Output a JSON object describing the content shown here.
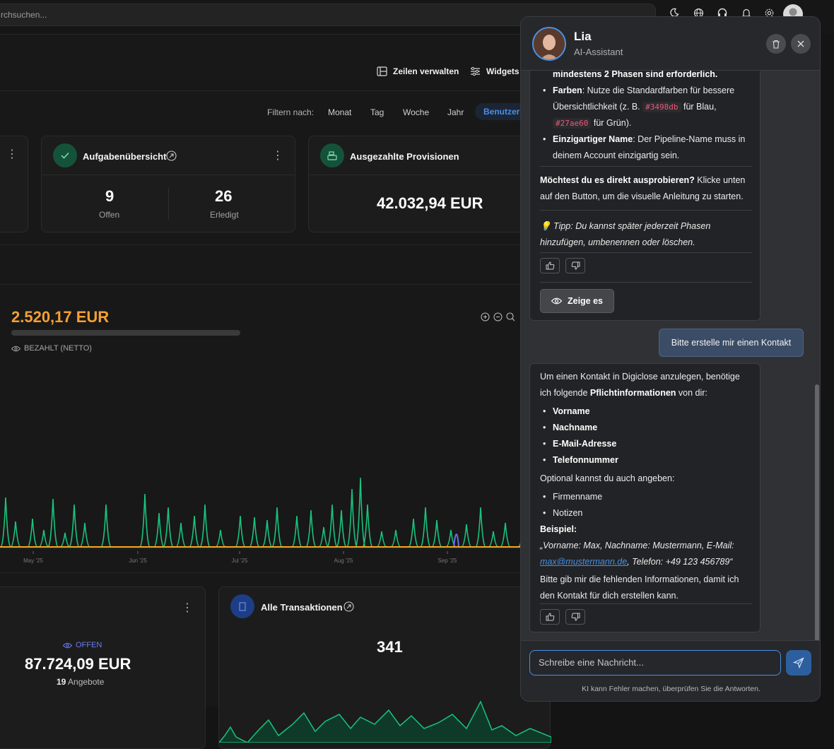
{
  "search": {
    "placeholder": "rchsuchen..."
  },
  "toolbar": {
    "rows_label": "Zeilen verwalten",
    "widgets_label": "Widgets"
  },
  "filter": {
    "label": "Filtern nach:",
    "items": [
      "Monat",
      "Tag",
      "Woche",
      "Jahr"
    ],
    "active": "Benutzerd"
  },
  "tasks": {
    "title": "Aufgabenübersicht",
    "open_value": "9",
    "open_label": "Offen",
    "done_value": "26",
    "done_label": "Erledigt"
  },
  "commissions": {
    "title": "Ausgezahlte Provisionen",
    "value": "42.032,94 EUR"
  },
  "revenue": {
    "value": "2.520,17 EUR",
    "label": "BEZAHLT (NETTO)"
  },
  "chart_data": {
    "type": "line",
    "x_ticks": [
      "May '25",
      "Jun '25",
      "Jul '25",
      "Aug '25",
      "Sep '25"
    ],
    "series_colors": [
      "#19c37d",
      "#f5a623",
      "#6c6cf0"
    ]
  },
  "offers": {
    "status": "OFFEN",
    "value": "87.724,09 EUR",
    "count": "19",
    "count_label": "Angebote"
  },
  "transactions": {
    "title": "Alle Transaktionen",
    "value": "341"
  },
  "chat": {
    "name": "Lia",
    "role": "AI-Assistant",
    "msg1": {
      "cut_line": "mindestens 2 Phasen sind erforderlich.",
      "b_colors": "Farben",
      "t_colors1": ": Nutze die Standardfarben für bessere",
      "t_colors2": "Übersichtlichkeit (z. B.",
      "code_blue": "#3498db",
      "t_blue": "für Blau,",
      "code_green": "#27ae60",
      "t_green": "für Grün).",
      "b_name": "Einzigartiger Name",
      "t_name1": ": Der Pipeline-Name muss in",
      "t_name2": "deinem Account einzigartig sein.",
      "b_try": "Möchtest du es direkt ausprobieren?",
      "t_try1": " Klicke unten",
      "t_try2": "auf den Button, um die visuelle Anleitung zu starten.",
      "tip1": "💡 Tipp: Du kannst später jederzeit Phasen",
      "tip2": "hinzufügen, umbenennen oder löschen.",
      "show_button": "Zeige es"
    },
    "user_msg": "Bitte erstelle mir einen Kontakt",
    "msg2": {
      "intro1": "Um einen Kontakt in Digiclose anzulegen, benötige",
      "intro2a": "ich folgende ",
      "intro2b": "Pflichtinformationen",
      "intro2c": " von dir:",
      "required": [
        "Vorname",
        "Nachname",
        "E-Mail-Adresse",
        "Telefonnummer"
      ],
      "optional_intro": "Optional kannst du auch angeben:",
      "optional": [
        "Firmenname",
        "Notizen"
      ],
      "example_label": "Beispiel:",
      "example1": "„Vorname: Max, Nachname: Mustermann, E-Mail:",
      "example_link": "max@mustermann.de",
      "example2": ", Telefon: +49 123 456789“",
      "outro1": "Bitte gib mir die fehlenden Informationen, damit ich",
      "outro2": "den Kontakt für dich erstellen kann."
    },
    "input_placeholder": "Schreibe eine Nachricht...",
    "disclaimer": "KI kann Fehler machen, überprüfen Sie die Antworten."
  }
}
